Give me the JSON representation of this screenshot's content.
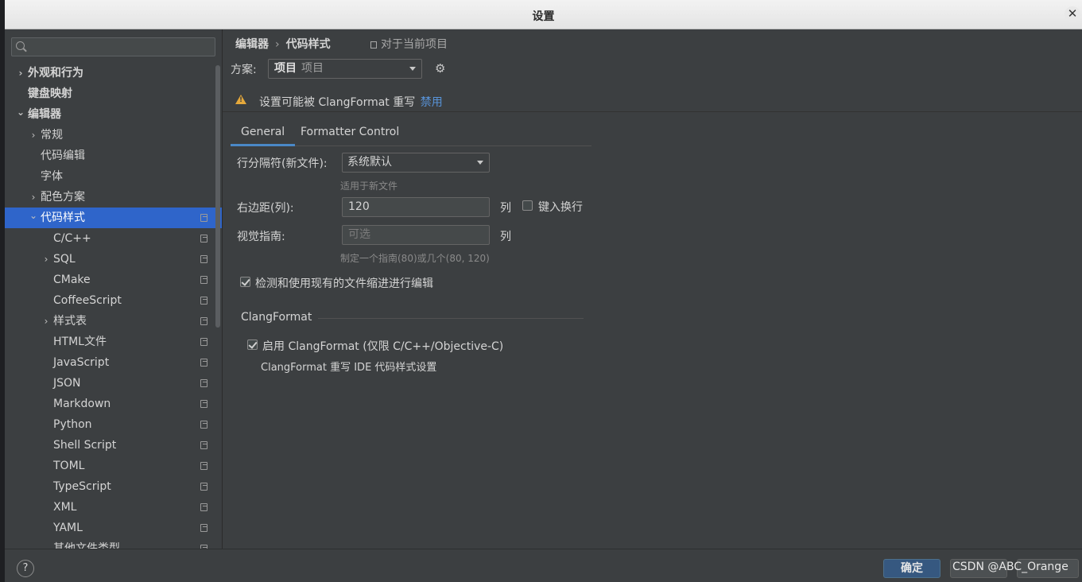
{
  "window": {
    "title": "设置",
    "close_glyph": "✕"
  },
  "search": {
    "placeholder": ""
  },
  "sidebar": {
    "items": [
      {
        "label": "外观和行为",
        "level": 0,
        "chevron": "›",
        "bold": true
      },
      {
        "label": "键盘映射",
        "level": 0,
        "chevron": "",
        "bold": true
      },
      {
        "label": "编辑器",
        "level": 0,
        "chevron": "⌄",
        "bold": true
      },
      {
        "label": "常规",
        "level": 1,
        "chevron": "›"
      },
      {
        "label": "代码编辑",
        "level": 1,
        "chevron": ""
      },
      {
        "label": "字体",
        "level": 1,
        "chevron": ""
      },
      {
        "label": "配色方案",
        "level": 1,
        "chevron": "›"
      },
      {
        "label": "代码样式",
        "level": 1,
        "chevron": "⌄",
        "selected": true,
        "copy": true
      },
      {
        "label": "C/C++",
        "level": 2,
        "chevron": "",
        "copy": true
      },
      {
        "label": "SQL",
        "level": 2,
        "chevron": "›",
        "copy": true
      },
      {
        "label": "CMake",
        "level": 2,
        "chevron": "",
        "copy": true
      },
      {
        "label": "CoffeeScript",
        "level": 2,
        "chevron": "",
        "copy": true
      },
      {
        "label": "样式表",
        "level": 2,
        "chevron": "›",
        "copy": true
      },
      {
        "label": "HTML文件",
        "level": 2,
        "chevron": "",
        "copy": true
      },
      {
        "label": "JavaScript",
        "level": 2,
        "chevron": "",
        "copy": true
      },
      {
        "label": "JSON",
        "level": 2,
        "chevron": "",
        "copy": true
      },
      {
        "label": "Markdown",
        "level": 2,
        "chevron": "",
        "copy": true
      },
      {
        "label": "Python",
        "level": 2,
        "chevron": "",
        "copy": true
      },
      {
        "label": "Shell Script",
        "level": 2,
        "chevron": "",
        "copy": true
      },
      {
        "label": "TOML",
        "level": 2,
        "chevron": "",
        "copy": true
      },
      {
        "label": "TypeScript",
        "level": 2,
        "chevron": "",
        "copy": true
      },
      {
        "label": "XML",
        "level": 2,
        "chevron": "",
        "copy": true
      },
      {
        "label": "YAML",
        "level": 2,
        "chevron": "",
        "copy": true
      },
      {
        "label": "其他文件类型",
        "level": 2,
        "chevron": "",
        "copy": true
      }
    ]
  },
  "breadcrumb": {
    "part1": "编辑器",
    "separator": "›",
    "part2": "代码样式",
    "note": "对于当前项目"
  },
  "scheme": {
    "label": "方案:",
    "value_bold": "项目",
    "value_sub": "项目"
  },
  "warning": {
    "text": "设置可能被 ClangFormat 重写",
    "link": "禁用"
  },
  "tabs": [
    {
      "label": "General",
      "active": true
    },
    {
      "label": "Formatter Control",
      "active": false
    }
  ],
  "general": {
    "line_separator_label": "行分隔符(新文件):",
    "line_separator_value": "系统默认",
    "line_separator_hint": "适用于新文件",
    "right_margin_label": "右边距(列):",
    "right_margin_value": "120",
    "right_margin_unit": "列",
    "wrap_on_typing_label": "键入换行",
    "wrap_on_typing_checked": false,
    "visual_guides_label": "视觉指南:",
    "visual_guides_placeholder": "可选",
    "visual_guides_unit": "列",
    "visual_guides_hint": "制定一个指南(80)或几个(80, 120)",
    "detect_indent_label": "检测和使用现有的文件缩进进行编辑",
    "detect_indent_checked": true
  },
  "clangformat": {
    "group_title": "ClangFormat",
    "enable_label": "启用 ClangFormat (仅限 C/C++/Objective-C)",
    "enable_checked": true,
    "note": "ClangFormat 重写 IDE 代码样式设置"
  },
  "footer": {
    "help": "?",
    "ok": "确定",
    "watermark": "CSDN @ABC_Orange"
  }
}
